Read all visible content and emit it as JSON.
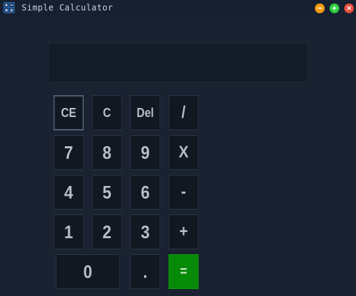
{
  "window": {
    "title": "Simple Calculator",
    "icon": "calculator-icon",
    "controls": {
      "minimize_icon": "minus-icon",
      "maximize_icon": "plus-icon",
      "close_icon": "x-icon",
      "minimize_glyph": "−",
      "maximize_glyph": "+",
      "close_glyph": "×",
      "minimize_color": "#f39c12",
      "maximize_color": "#2ecc40",
      "close_color": "#e74c3c"
    }
  },
  "display": {
    "value": ""
  },
  "keypad": {
    "ce": "CE",
    "c": "C",
    "del": "Del",
    "divide": "/",
    "seven": "7",
    "eight": "8",
    "nine": "9",
    "multiply": "X",
    "four": "4",
    "five": "5",
    "six": "6",
    "minus": "-",
    "one": "1",
    "two": "2",
    "three": "3",
    "plus": "+",
    "zero": "0",
    "decimal": ".",
    "equals": "="
  },
  "colors": {
    "background": "#1a2231",
    "key_background": "#111822",
    "equals_background": "#078a07",
    "key_text": "#b9bec6"
  }
}
